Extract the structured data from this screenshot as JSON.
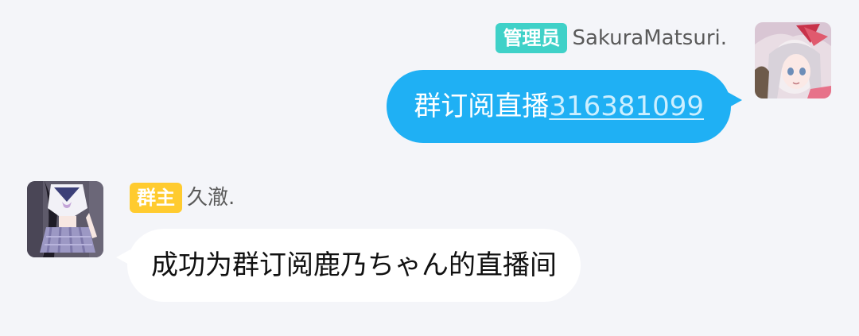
{
  "messages": [
    {
      "side": "right",
      "badge": "管理员",
      "badge_color": "#3fd1c8",
      "sender": "SakuraMatsuri.",
      "text": "群订阅直播",
      "link": "316381099",
      "bubble_color": "#1fb0f4",
      "avatar_icon": "anime-girl-avatar"
    },
    {
      "side": "left",
      "badge": "群主",
      "badge_color": "#ffcb2f",
      "sender": "久澈.",
      "text": "成功为群订阅鹿乃ちゃん的直播间",
      "bubble_color": "#ffffff",
      "avatar_icon": "sailor-uniform-avatar"
    }
  ],
  "colors": {
    "background": "#f4f5f9",
    "name_text": "#5a5a5a"
  }
}
